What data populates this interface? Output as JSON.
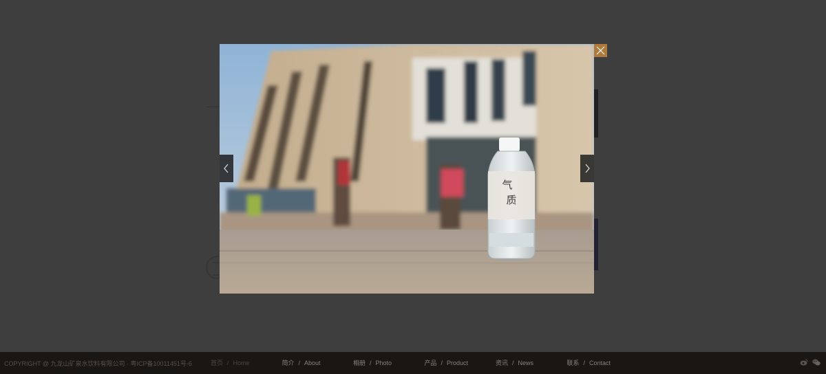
{
  "lightbox": {
    "photo_alt": "Bottle of water on a plaza in front of a building",
    "bottle_label_line1": "气",
    "bottle_label_line2": "质",
    "prev_icon": "chevron-left-icon",
    "next_icon": "chevron-right-icon",
    "close_icon": "close-icon",
    "close_color": "#b07a3c"
  },
  "footer": {
    "copyright": "COPYRIGHT @ 九龙山矿泉水饮料有限公司 · 粤ICP备10011451号-6",
    "nav": [
      {
        "cn": "首页",
        "en": "Home",
        "active": true
      },
      {
        "cn": "简介",
        "en": "About"
      },
      {
        "cn": "相册",
        "en": "Photo"
      },
      {
        "cn": "产品",
        "en": "Product"
      },
      {
        "cn": "资讯",
        "en": "News"
      },
      {
        "cn": "联系",
        "en": "Contact"
      }
    ],
    "separator": "/",
    "icons": [
      "weibo-icon",
      "wechat-icon"
    ]
  }
}
